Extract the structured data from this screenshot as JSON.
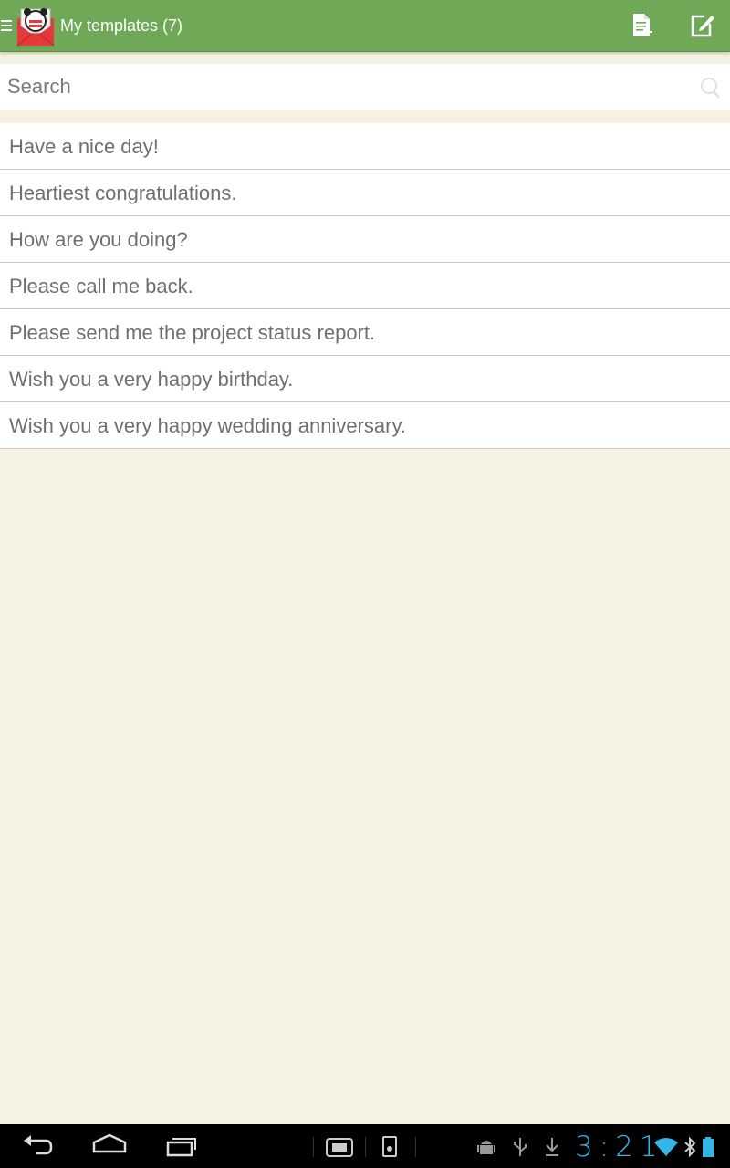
{
  "action_bar": {
    "title": "My templates (7)",
    "menu_icon": "menu-icon",
    "logo_icon": "app-logo-icon",
    "import_icon": "document-add-icon",
    "compose_icon": "compose-icon",
    "bar_color": "#6fa856"
  },
  "search": {
    "placeholder": "Search",
    "value": "",
    "icon": "search-icon"
  },
  "templates": [
    "Have a nice day!",
    "Heartiest congratulations.",
    "How are you doing?",
    "Please call me back.",
    "Please send me the project status report.",
    "Wish you a very happy birthday.",
    "Wish you a very happy wedding anniversary."
  ],
  "system_bar": {
    "clock": "3:21",
    "clock_color": "#33b5e5",
    "icons": [
      "back-icon",
      "home-icon",
      "recent-apps-icon",
      "screenshot-icon",
      "sd-card-icon",
      "android-debug-icon",
      "usb-icon",
      "download-icon",
      "wifi-icon",
      "bluetooth-icon",
      "battery-icon"
    ]
  },
  "colors": {
    "background": "#f5f2e3",
    "list_text": "#6f6f6f",
    "divider": "#c9c9c9"
  }
}
